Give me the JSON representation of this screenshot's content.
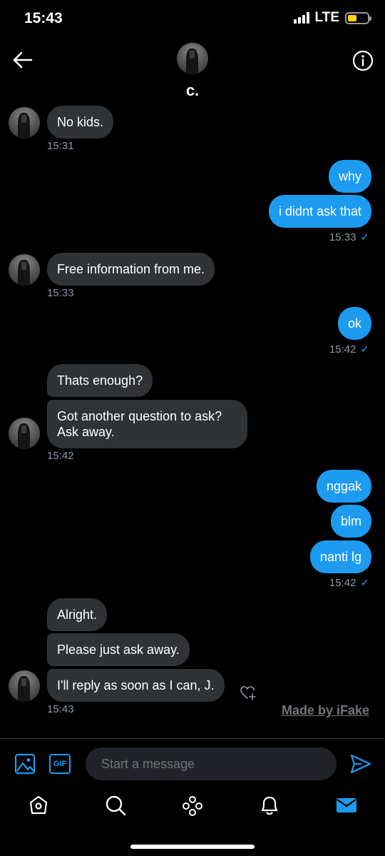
{
  "status_bar": {
    "time": "15:43",
    "network": "LTE"
  },
  "header": {
    "name": "c."
  },
  "messages": [
    {
      "text": "No kids."
    },
    {
      "text": "why"
    },
    {
      "text": "i didnt ask that"
    },
    {
      "text": "Free information from me."
    },
    {
      "text": "ok"
    },
    {
      "text": "Thats enough?"
    },
    {
      "text": "Got another question to ask?"
    },
    {
      "text": "Ask away."
    },
    {
      "text": "nggak"
    },
    {
      "text": "blm"
    },
    {
      "text": "nanti lg"
    },
    {
      "text": "Alright."
    },
    {
      "text": "Please just ask away."
    },
    {
      "text": "I'll reply as soon as I can, J."
    }
  ],
  "timestamps": [
    "15:31",
    "15:33",
    "15:33",
    "15:42",
    "15:42",
    "15:42",
    "15:43"
  ],
  "watermark": "Made by iFake",
  "composer": {
    "placeholder": "Start a message",
    "gif_label": "GIF"
  },
  "colors": {
    "accent": "#1d9bf0",
    "incoming_bubble": "#2f3336",
    "background": "#000000"
  },
  "icons": [
    "back-arrow-icon",
    "info-icon",
    "image-icon",
    "gif-icon",
    "send-icon",
    "home-icon",
    "search-icon",
    "spaces-icon",
    "bell-icon",
    "mail-icon",
    "heart-add-icon"
  ]
}
